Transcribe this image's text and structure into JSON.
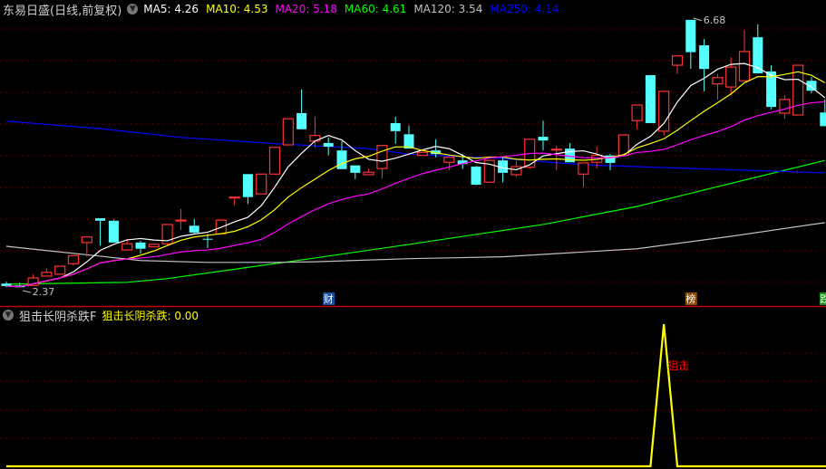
{
  "header": {
    "title": "东易日盛(日线,前复权)",
    "ma_labels": [
      {
        "label": "MA5: ",
        "value": "4.26",
        "color": "#ffffff"
      },
      {
        "label": "MA10: ",
        "value": "4.53",
        "color": "#ffff00"
      },
      {
        "label": "MA20: ",
        "value": "5.18",
        "color": "#ff00ff"
      },
      {
        "label": "MA60: ",
        "value": "4.61",
        "color": "#00ff00"
      },
      {
        "label": "MA120: ",
        "value": "3.54",
        "color": "#c0c0c0"
      },
      {
        "label": "MA250: ",
        "value": "4.14",
        "color": "#0000ff"
      }
    ]
  },
  "indicator_header": {
    "name": "狙击长阴杀跌F",
    "value_label": "狙击长阴杀跌: ",
    "value": "0.00",
    "value_color": "#ffff00"
  },
  "colors": {
    "up": "#ff3232",
    "down": "#54ffff",
    "grid": "#8b0000",
    "separator": "#c00000"
  },
  "chart_data": [
    {
      "type": "candlestick",
      "title": "东易日盛(日线,前复权)",
      "ylim": [
        2.37,
        6.68
      ],
      "candles": [
        [
          2.44,
          2.47,
          2.38,
          2.4
        ],
        [
          2.41,
          2.46,
          2.38,
          2.38
        ],
        [
          2.41,
          2.59,
          2.41,
          2.53
        ],
        [
          2.56,
          2.68,
          2.56,
          2.62
        ],
        [
          2.59,
          2.72,
          2.59,
          2.72
        ],
        [
          2.76,
          2.89,
          2.73,
          2.89
        ],
        [
          3.1,
          3.19,
          2.87,
          3.19
        ],
        [
          3.49,
          3.49,
          3.05,
          3.45
        ],
        [
          3.45,
          3.47,
          3.1,
          3.1
        ],
        [
          2.98,
          3.16,
          2.98,
          3.08
        ],
        [
          3.1,
          3.13,
          2.92,
          3.0
        ],
        [
          3.03,
          3.08,
          3.03,
          3.07
        ],
        [
          3.08,
          3.39,
          3.05,
          3.39
        ],
        [
          3.46,
          3.64,
          3.3,
          3.46
        ],
        [
          3.37,
          3.48,
          3.24,
          3.26
        ],
        [
          3.16,
          3.24,
          3.01,
          3.15
        ],
        [
          3.24,
          3.46,
          3.24,
          3.46
        ],
        [
          3.83,
          3.83,
          3.7,
          3.83
        ],
        [
          4.2,
          4.2,
          3.72,
          3.83
        ],
        [
          3.88,
          4.2,
          3.88,
          4.2
        ],
        [
          4.2,
          4.63,
          4.2,
          4.63
        ],
        [
          4.67,
          5.09,
          4.67,
          5.09
        ],
        [
          5.18,
          5.56,
          4.92,
          4.92
        ],
        [
          4.73,
          5.12,
          4.63,
          4.82
        ],
        [
          4.7,
          4.79,
          4.5,
          4.64
        ],
        [
          4.58,
          4.73,
          4.28,
          4.28
        ],
        [
          4.34,
          4.34,
          4.12,
          4.22
        ],
        [
          4.19,
          4.29,
          4.19,
          4.23
        ],
        [
          4.29,
          4.66,
          4.13,
          4.66
        ],
        [
          5.02,
          5.12,
          4.69,
          4.89
        ],
        [
          4.84,
          4.98,
          4.61,
          4.61
        ],
        [
          4.5,
          4.56,
          4.5,
          4.55
        ],
        [
          4.58,
          4.76,
          4.47,
          4.52
        ],
        [
          4.39,
          4.47,
          4.26,
          4.47
        ],
        [
          4.42,
          4.52,
          4.28,
          4.36
        ],
        [
          4.32,
          4.33,
          4.02,
          4.03
        ],
        [
          4.07,
          4.42,
          4.07,
          4.42
        ],
        [
          4.42,
          4.48,
          4.07,
          4.22
        ],
        [
          4.19,
          4.41,
          4.15,
          4.32
        ],
        [
          4.31,
          4.76,
          4.28,
          4.76
        ],
        [
          4.8,
          5.06,
          4.58,
          4.74
        ],
        [
          4.6,
          4.66,
          4.26,
          4.6
        ],
        [
          4.61,
          4.7,
          4.39,
          4.39
        ],
        [
          4.2,
          4.38,
          3.99,
          4.38
        ],
        [
          4.39,
          4.64,
          4.29,
          4.5
        ],
        [
          4.5,
          4.52,
          4.26,
          4.38
        ],
        [
          4.5,
          4.83,
          4.5,
          4.83
        ],
        [
          5.06,
          5.31,
          4.92,
          5.31
        ],
        [
          5.79,
          5.79,
          5.02,
          5.02
        ],
        [
          4.89,
          5.53,
          4.82,
          5.53
        ],
        [
          5.95,
          6.1,
          5.81,
          6.1
        ],
        [
          6.68,
          6.68,
          5.89,
          6.16
        ],
        [
          6.27,
          6.37,
          5.53,
          5.89
        ],
        [
          5.65,
          5.81,
          5.4,
          5.75
        ],
        [
          5.6,
          6.08,
          5.46,
          5.92
        ],
        [
          5.7,
          6.52,
          5.7,
          6.17
        ],
        [
          6.4,
          6.61,
          5.82,
          5.82
        ],
        [
          5.85,
          5.95,
          5.24,
          5.28
        ],
        [
          5.18,
          5.47,
          5.09,
          5.4
        ],
        [
          5.15,
          5.95,
          5.15,
          5.95
        ],
        [
          5.7,
          5.76,
          5.5,
          5.54
        ],
        [
          5.19,
          5.4,
          4.97,
          4.97
        ]
      ],
      "computed_ma": [
        {
          "name": "MA5",
          "period": 5,
          "color": "#ffffff"
        },
        {
          "name": "MA10",
          "period": 10,
          "color": "#ffff00"
        },
        {
          "name": "MA20",
          "period": 20,
          "color": "#ff00ff"
        }
      ],
      "sampled_ma": [
        {
          "name": "MA60",
          "color": "#00ff00",
          "points": [
            [
              0,
              2.43
            ],
            [
              9,
              2.46
            ],
            [
              12,
              2.52
            ],
            [
              22,
              2.82
            ],
            [
              30,
              3.07
            ],
            [
              40,
              3.39
            ],
            [
              47,
              3.68
            ],
            [
              61,
              4.42
            ]
          ]
        },
        {
          "name": "MA120",
          "color": "#c0c0c0",
          "points": [
            [
              0,
              3.04
            ],
            [
              3,
              2.97
            ],
            [
              7,
              2.88
            ],
            [
              10,
              2.81
            ],
            [
              15,
              2.78
            ],
            [
              20,
              2.78
            ],
            [
              23,
              2.79
            ],
            [
              30,
              2.84
            ],
            [
              37,
              2.87
            ],
            [
              47,
              3.0
            ],
            [
              54,
              3.2
            ],
            [
              61,
              3.42
            ]
          ]
        },
        {
          "name": "MA250",
          "color": "#0000ff",
          "points": [
            [
              0,
              5.05
            ],
            [
              7,
              4.93
            ],
            [
              13,
              4.79
            ],
            [
              20,
              4.69
            ],
            [
              27,
              4.61
            ],
            [
              30,
              4.52
            ],
            [
              37,
              4.45
            ],
            [
              43,
              4.35
            ],
            [
              51,
              4.29
            ],
            [
              61,
              4.22
            ]
          ]
        }
      ],
      "annotations": [
        {
          "text": "6.68",
          "index": 51,
          "price": 6.68,
          "kind": "high"
        },
        {
          "text": "2.37",
          "index": 1,
          "price": 2.37,
          "kind": "low"
        }
      ],
      "event_markers": [
        {
          "text": "财",
          "index": 24,
          "color": "#1a4f9c"
        },
        {
          "text": "榜",
          "index": 51,
          "color": "#8b4a00"
        },
        {
          "text": "跌",
          "index": 61,
          "color": "#1a8a1a"
        }
      ]
    },
    {
      "type": "line",
      "name": "狙击长阴杀跌",
      "color": "#ffff00",
      "ylim": [
        0,
        1
      ],
      "values": [
        0,
        0,
        0,
        0,
        0,
        0,
        0,
        0,
        0,
        0,
        0,
        0,
        0,
        0,
        0,
        0,
        0,
        0,
        0,
        0,
        0,
        0,
        0,
        0,
        0,
        0,
        0,
        0,
        0,
        0,
        0,
        0,
        0,
        0,
        0,
        0,
        0,
        0,
        0,
        0,
        0,
        0,
        0,
        0,
        0,
        0,
        0,
        0,
        0,
        1,
        0,
        0,
        0,
        0,
        0,
        0,
        0,
        0,
        0,
        0,
        0,
        0
      ],
      "signal_label": {
        "text": "狙击",
        "index": 49,
        "color": "#ff0000"
      }
    }
  ]
}
